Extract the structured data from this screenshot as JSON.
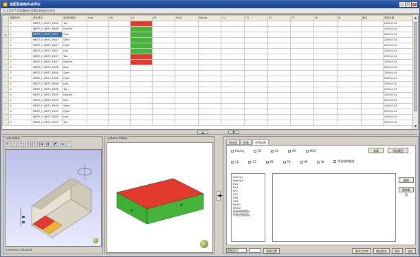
{
  "window": {
    "title": "选配及结构件点评价",
    "subtitle": "A; 2 8 8 T 切设备单元设置及结构的点评价",
    "min": "_",
    "max": "□",
    "close": "×"
  },
  "grid": {
    "columns": [
      "组图序号",
      "单元体ID",
      "单元所属ID",
      "Last",
      "RV",
      "LR",
      "UR",
      "MUR",
      "Rating",
      "C2",
      "C3",
      "P3",
      "P2",
      "IM",
      "IN",
      "备注",
      "完成日期"
    ],
    "rows": [
      {
        "num": "2",
        "id": "MBTZ_F_DNTC_FN00",
        "part": "Top",
        "date": "2009-8-04",
        "lr": "red"
      },
      {
        "num": "2",
        "id": "MBTZ_F_DNTC_FN00",
        "part": "Bottom",
        "date": "2009-8-04",
        "lr": "green"
      },
      {
        "num": "2",
        "id": "MBTZ_F_DNTC_FN07",
        "part": "Row",
        "date": "2009-8-04",
        "lr": "green",
        "selected": true
      },
      {
        "num": "2",
        "id": "MBTZ_F_DNTC_FN07",
        "part": "Stern",
        "date": "2009-8-04",
        "lr": "green"
      },
      {
        "num": "2",
        "id": "MBTZ_F_DNTC_FN07",
        "part": "Right",
        "date": "2009-8-04",
        "lr": "green"
      },
      {
        "num": "2",
        "id": "MBTZ_F_DNTC_FN07",
        "part": "Left",
        "date": "2009-8-04",
        "lr": "green"
      },
      {
        "num": "2",
        "id": "MBTZ_F_DNTC_FN07",
        "part": "Top",
        "date": "2009-8-04",
        "lr": "red"
      },
      {
        "num": "2",
        "id": "MBTZ_F_DNTC_FN07",
        "part": "Bottom",
        "date": "2009-8-04",
        "lr": "red"
      },
      {
        "num": "3",
        "id": "MBTZ_F_DNTC_FN08",
        "part": "Row",
        "date": "2009-8-04",
        "lr": ""
      },
      {
        "num": "3",
        "id": "MBTZ_F_DNTC_FN08",
        "part": "Stern",
        "date": "2009-8-04",
        "lr": ""
      },
      {
        "num": "3",
        "id": "MBTZ_F_DNTC_FN08",
        "part": "Right",
        "date": "2009-8-04",
        "lr": ""
      },
      {
        "num": "3",
        "id": "MBTZ_F_DNTC_FN08",
        "part": "Left",
        "date": "2009-8-04",
        "lr": ""
      },
      {
        "num": "3",
        "id": "MBTZ_F_DNTC_FN08",
        "part": "Top",
        "date": "2009-8-04",
        "lr": ""
      },
      {
        "num": "4",
        "id": "MBTZ_F_DNTC_FN09",
        "part": "Bottom",
        "date": "2009-8-04",
        "lr": ""
      },
      {
        "num": "4",
        "id": "MBTZ_F_DNTC_FN09",
        "part": "Row",
        "date": "2009-8-04",
        "lr": ""
      },
      {
        "num": "4",
        "id": "MBTZ_F_DNTC_FN09",
        "part": "Stern",
        "date": "2009-8-04",
        "lr": ""
      },
      {
        "num": "4",
        "id": "MBTZ_F_DNTC_FN09",
        "part": "Right",
        "date": "2009-8-04",
        "lr": ""
      },
      {
        "num": "4",
        "id": "MBTZ_F_DNTC_FN09",
        "part": "Left",
        "date": "2009-8-04",
        "lr": ""
      },
      {
        "num": "4",
        "id": "MBTZ_F_DNTC_FN09",
        "part": "Top",
        "date": "2009-8-04",
        "lr": ""
      }
    ]
  },
  "panels": {
    "model3d_title": "设备3D模型",
    "cell3d_title": "设备单元3D模型",
    "status_text": "1 element selected"
  },
  "right": {
    "tabs": [
      "单元项",
      "检查",
      "评语对照"
    ],
    "check_row1": [
      "Rating",
      "RV",
      "LR",
      "UR",
      "MUR"
    ],
    "check_row1_on": [
      false,
      false,
      true,
      false,
      false
    ],
    "check_row2": [
      "C2",
      "C3",
      "P3",
      "P2",
      "IM",
      "IN",
      "所有结构缺陷"
    ],
    "btn_query": "查看",
    "btn_add_model": "添加模型",
    "btn_icon": "截图",
    "btn_delete_icon": "删除截图",
    "list_items": [
      "Rating1",
      "Rating2",
      "RV1",
      "RV2",
      "LR1",
      "LR2",
      "UR1",
      "UR2",
      "MUR1",
      "MUR2",
      "所有结构缺陷1",
      "所有结构缺陷2"
    ],
    "combo_label": "数据选中",
    "btn_save_view": "视图位置",
    "btn_batch_save": "选择工作单",
    "btn_export": "输出报告",
    "btn_save": "保存",
    "btn_exit": "退出"
  },
  "colors": {
    "title_bar": "#1c3f8a",
    "selected_row": "#3a6ea5",
    "red_status": "#e23b2e",
    "green_status": "#46b43a"
  }
}
